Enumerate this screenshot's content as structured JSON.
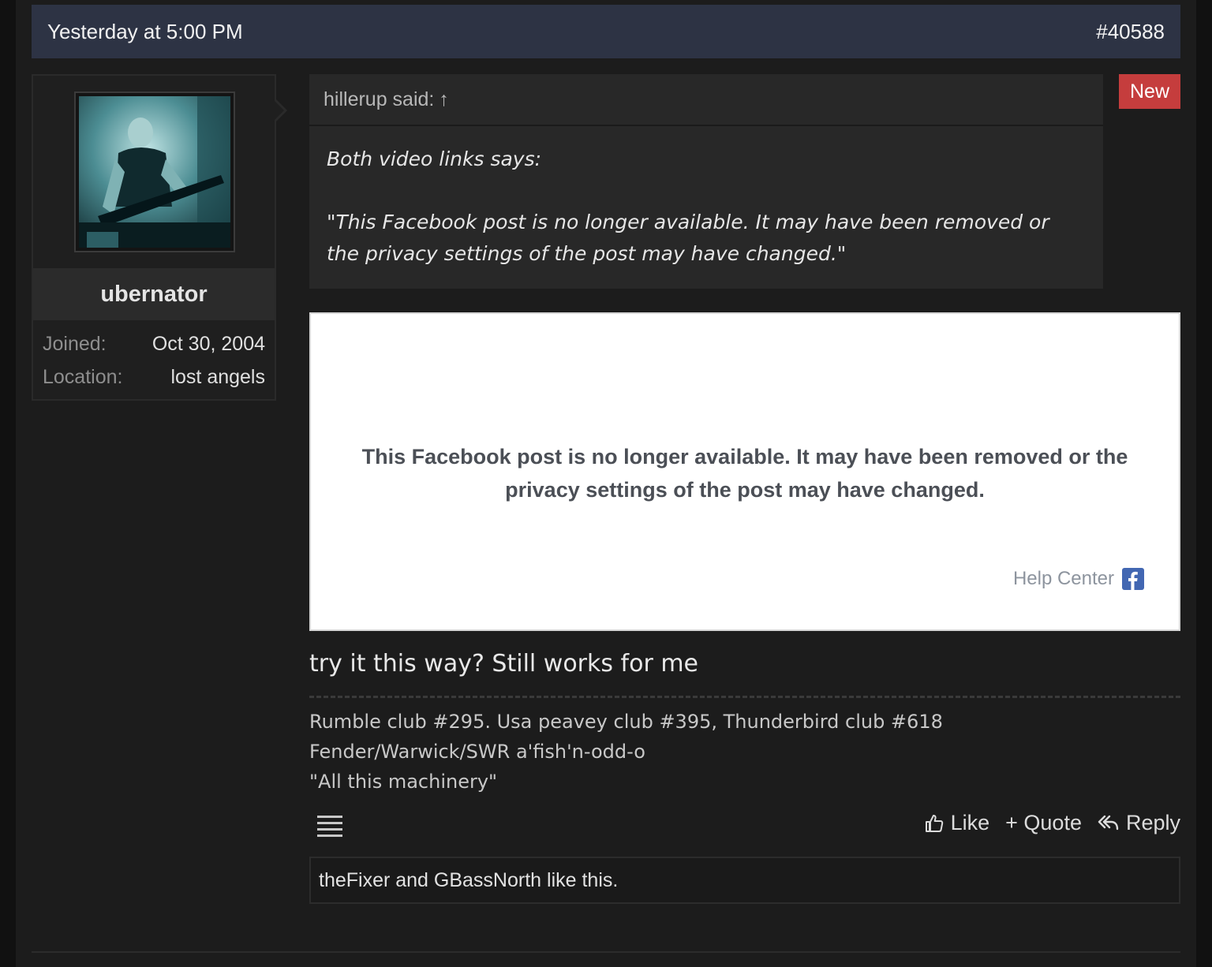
{
  "post": {
    "timestamp": "Yesterday at 5:00 PM",
    "number": "#40588",
    "new_badge": "New"
  },
  "user": {
    "name": "ubernator",
    "joined_label": "Joined:",
    "joined_value": "Oct 30, 2004",
    "location_label": "Location:",
    "location_value": "lost angels"
  },
  "quote": {
    "author_line": "hillerup said:",
    "jump_icon": "↑",
    "line1": "Both video links says:",
    "line2": "\"This Facebook post is no longer available. It may have been removed or",
    "line3": "the privacy settings of the post may have changed.\""
  },
  "embed": {
    "message_line1": "This Facebook post is no longer available. It may have been removed or the",
    "message_line2": "privacy settings of the post may have changed.",
    "help_center": "Help Center",
    "logo_letter": "f"
  },
  "body": {
    "text": "try it this way? Still works for me"
  },
  "signature": {
    "line1": "Rumble club #295. Usa peavey club #395, Thunderbird club #618",
    "line2": "Fender/Warwick/SWR a'fish'n-odd-o",
    "line3": "\"All this machinery\""
  },
  "actions": {
    "like": "Like",
    "quote": "+ Quote",
    "reply": "Reply"
  },
  "likes": {
    "text": "theFixer and GBassNorth like this."
  },
  "colors": {
    "header_bg": "#2d3344",
    "new_badge": "#c53d3d",
    "facebook_blue": "#4267b2"
  },
  "icons": [
    "arrow-up-icon",
    "thumbs-up-icon",
    "reply-icon",
    "menu-icon",
    "facebook-icon"
  ]
}
